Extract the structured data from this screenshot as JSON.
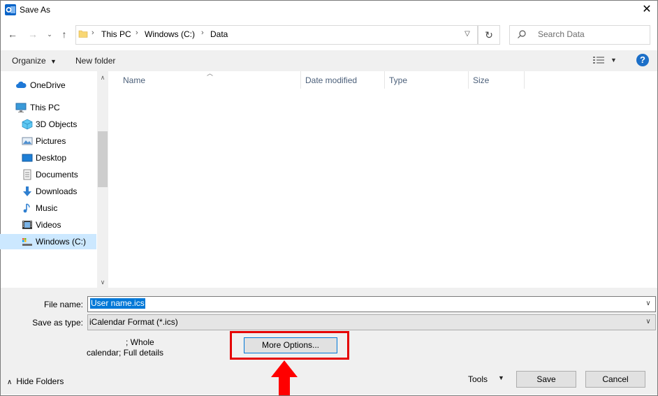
{
  "window": {
    "title": "Save As"
  },
  "address_bar": {
    "crumbs": [
      "This PC",
      "Windows (C:)",
      "Data"
    ]
  },
  "search": {
    "placeholder": "Search Data"
  },
  "toolbar": {
    "organize_label": "Organize",
    "new_folder_label": "New folder"
  },
  "nav_pane": {
    "items": [
      {
        "label": "OneDrive",
        "icon": "onedrive-cloud-icon"
      },
      {
        "label": "This PC",
        "icon": "computer-icon"
      },
      {
        "label": "3D Objects",
        "icon": "3d-objects-icon"
      },
      {
        "label": "Pictures",
        "icon": "pictures-icon"
      },
      {
        "label": "Desktop",
        "icon": "desktop-icon"
      },
      {
        "label": "Documents",
        "icon": "documents-icon"
      },
      {
        "label": "Downloads",
        "icon": "downloads-icon"
      },
      {
        "label": "Music",
        "icon": "music-icon"
      },
      {
        "label": "Videos",
        "icon": "videos-icon"
      },
      {
        "label": "Windows (C:)",
        "icon": "drive-icon",
        "selected": true
      }
    ]
  },
  "file_list": {
    "columns": [
      "Name",
      "Date modified",
      "Type",
      "Size"
    ]
  },
  "form": {
    "file_name_label": "File name:",
    "file_name_value": "User name.ics",
    "save_as_type_label": "Save as type:",
    "save_as_type_value": "iCalendar Format (*.ics)",
    "description_line1": "; Whole",
    "description_line2": "calendar; Full details",
    "more_options_label": "More Options..."
  },
  "footer": {
    "hide_folders_label": "Hide Folders",
    "tools_label": "Tools",
    "save_label": "Save",
    "cancel_label": "Cancel"
  },
  "colors": {
    "accent": "#0078d7",
    "highlight_annotation": "#e50000",
    "selected_nav": "#cce8ff",
    "panel_bg": "#f0f0f0"
  }
}
